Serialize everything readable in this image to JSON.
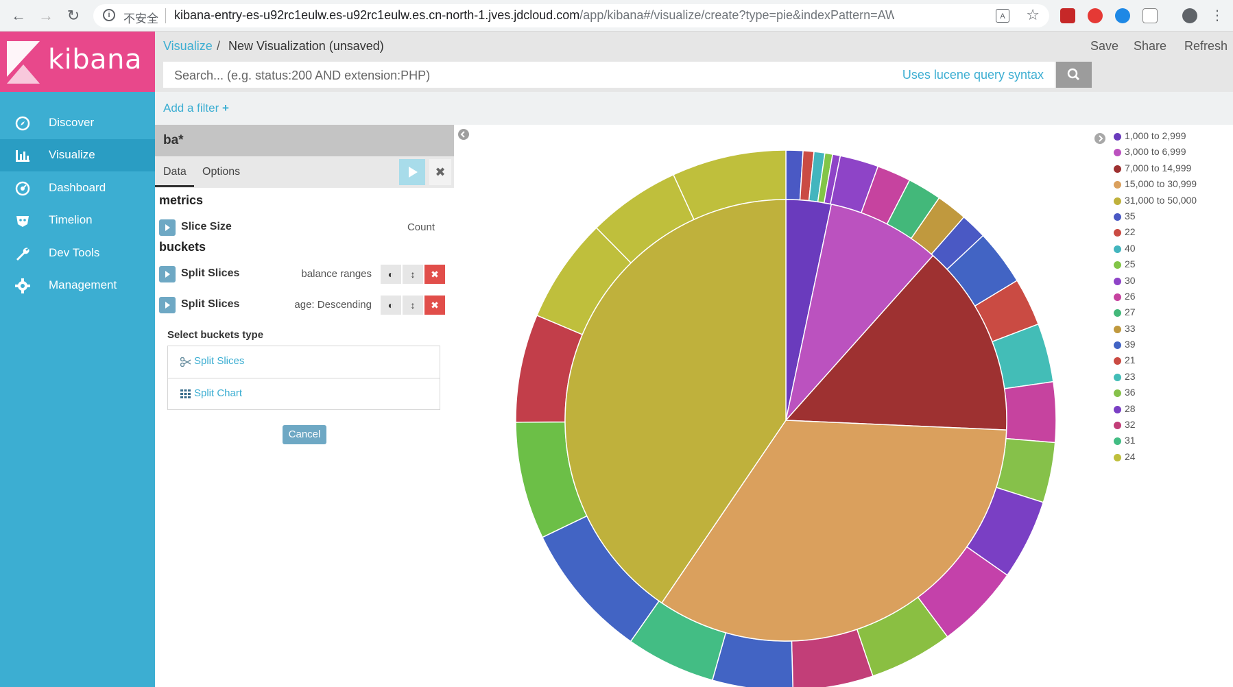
{
  "browser": {
    "insecure_label": "不安全",
    "url_host": "kibana-entry-es-u92rc1eulw.es-u92rc1eulw.es.cn-north-1.jves.jdcloud.com",
    "url_path": "/app/kibana#/visualize/create?type=pie&indexPattern=AWZhxw..."
  },
  "app": {
    "name": "kibana"
  },
  "sidebar": {
    "items": [
      {
        "label": "Discover"
      },
      {
        "label": "Visualize"
      },
      {
        "label": "Dashboard"
      },
      {
        "label": "Timelion"
      },
      {
        "label": "Dev Tools"
      },
      {
        "label": "Management"
      }
    ]
  },
  "topbar": {
    "breadcrumb_link": "Visualize",
    "breadcrumb_sep": "/",
    "title": "New Visualization (unsaved)",
    "save": "Save",
    "share": "Share",
    "refresh": "Refresh"
  },
  "search": {
    "placeholder": "Search... (e.g. status:200 AND extension:PHP)",
    "lucene_link": "Uses lucene query syntax"
  },
  "filter": {
    "add_label": "Add a filter"
  },
  "editor": {
    "index_title": "ba*",
    "tabs": [
      "Data",
      "Options"
    ],
    "metrics_heading": "metrics",
    "metric": {
      "name": "Slice Size",
      "desc": "Count"
    },
    "buckets_heading": "buckets",
    "buckets": [
      {
        "name": "Split Slices",
        "desc": "balance ranges"
      },
      {
        "name": "Split Slices",
        "desc": "age: Descending"
      }
    ],
    "select_label": "Select buckets type",
    "options": [
      "Split Slices",
      "Split Chart"
    ],
    "cancel": "Cancel"
  },
  "chart_data": {
    "type": "pie",
    "inner_ring": {
      "categories": [
        "1,000 to 2,999",
        "3,000 to 6,999",
        "7,000 to 14,999",
        "15,000 to 30,999",
        "31,000 to 50,000"
      ],
      "values": [
        3.3,
        8.3,
        14.1,
        33.8,
        40.5
      ],
      "colors": [
        "#6a3bbd",
        "#bb52bf",
        "#9e3131",
        "#daa05d",
        "#bfb13c"
      ]
    },
    "outer_ring": {
      "values": [
        1.1,
        0.7,
        0.7,
        0.5,
        0.5,
        2.5,
        2.2,
        2.2,
        2.0,
        1.7,
        3.6,
        3.1,
        3.8,
        3.9,
        3.9,
        5.2,
        5.5,
        5.4,
        5.2,
        5.2,
        5.8,
        8.8,
        7.6,
        7.0,
        6.8,
        6.0,
        7.4
      ],
      "colors": [
        "#4a59c4",
        "#ca4b43",
        "#43b5be",
        "#82c547",
        "#8e44c7",
        "#8e44c7",
        "#c6439f",
        "#43b87a",
        "#c0993e",
        "#4a59c4",
        "#4264c4",
        "#ca4b43",
        "#43bdb7",
        "#c6439f",
        "#86c14a",
        "#7a3fc4",
        "#c441aa",
        "#8abf42",
        "#c23e78",
        "#4264c4",
        "#43bd84",
        "#4264c4",
        "#6cbf47",
        "#c23e4a",
        "#bfbf3c",
        "#bfbf3c",
        "#bfbf3c"
      ]
    },
    "legend": [
      {
        "label": "1,000 to 2,999",
        "color": "#6a3bbd"
      },
      {
        "label": "3,000 to 6,999",
        "color": "#bb52bf"
      },
      {
        "label": "7,000 to 14,999",
        "color": "#9e3131"
      },
      {
        "label": "15,000 to 30,999",
        "color": "#daa05d"
      },
      {
        "label": "31,000 to 50,000",
        "color": "#bfb13c"
      },
      {
        "label": "35",
        "color": "#4a59c4"
      },
      {
        "label": "22",
        "color": "#ca4b43"
      },
      {
        "label": "40",
        "color": "#43b5be"
      },
      {
        "label": "25",
        "color": "#82c547"
      },
      {
        "label": "30",
        "color": "#8e44c7"
      },
      {
        "label": "26",
        "color": "#c6439f"
      },
      {
        "label": "27",
        "color": "#43b87a"
      },
      {
        "label": "33",
        "color": "#c0993e"
      },
      {
        "label": "39",
        "color": "#4264c4"
      },
      {
        "label": "21",
        "color": "#ca4b43"
      },
      {
        "label": "23",
        "color": "#43bdb7"
      },
      {
        "label": "36",
        "color": "#86c14a"
      },
      {
        "label": "28",
        "color": "#7a3fc4"
      },
      {
        "label": "32",
        "color": "#c23e78"
      },
      {
        "label": "31",
        "color": "#43bd84"
      },
      {
        "label": "24",
        "color": "#bfbf3c"
      }
    ]
  }
}
